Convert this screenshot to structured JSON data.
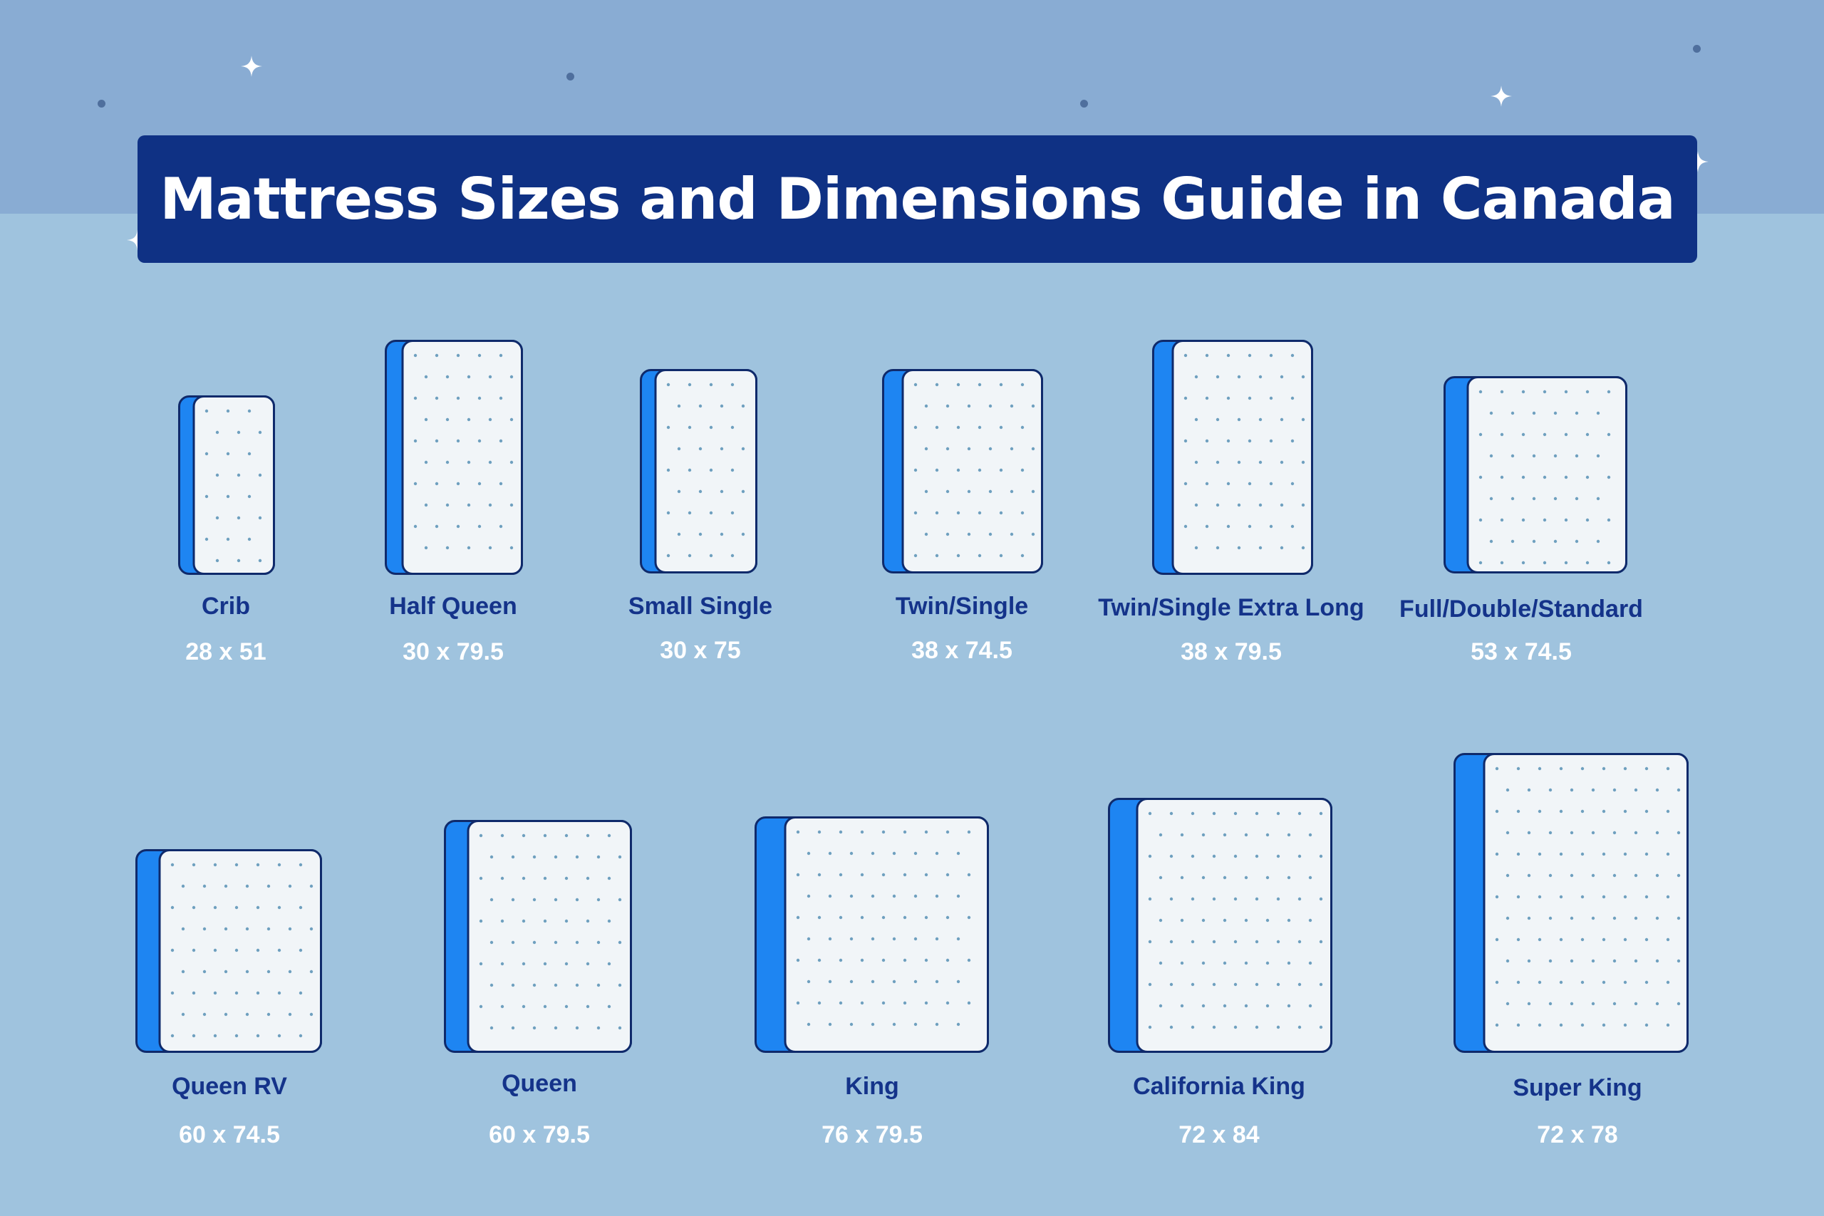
{
  "title": "Mattress Sizes and Dimensions Guide in Canada",
  "colors": {
    "background_top": "#89acd3",
    "background_main": "#9fc3de",
    "banner": "#0f3184",
    "mattress_side": "#1e85f2",
    "mattress_top": "#f1f5f8",
    "mattress_outline": "#0f2a6b",
    "mattress_dots": "#6fa0bf",
    "name_text": "#14338a",
    "dims_text": "#ffffff"
  },
  "decorations": {
    "stars": [
      "sparkle-icon",
      "sparkle-icon",
      "sparkle-icon",
      "sparkle-icon"
    ],
    "dots": [
      "dot-icon",
      "dot-icon",
      "dot-icon",
      "dot-icon"
    ]
  },
  "mattresses": [
    {
      "name": "Crib",
      "dimensions": "28 x 51"
    },
    {
      "name": "Half Queen",
      "dimensions": "30 x 79.5"
    },
    {
      "name": "Small Single",
      "dimensions": "30 x 75"
    },
    {
      "name": "Twin/Single",
      "dimensions": "38 x 74.5"
    },
    {
      "name": "Twin/Single Extra Long",
      "dimensions": "38 x 79.5"
    },
    {
      "name": "Full/Double/Standard",
      "dimensions": "53 x 74.5"
    },
    {
      "name": "Queen RV",
      "dimensions": "60 x 74.5"
    },
    {
      "name": "Queen",
      "dimensions": "60 x 79.5"
    },
    {
      "name": "King",
      "dimensions": "76 x 79.5"
    },
    {
      "name": "California King",
      "dimensions": "72 x 84"
    },
    {
      "name": "Super King",
      "dimensions": "72 x 78"
    }
  ]
}
